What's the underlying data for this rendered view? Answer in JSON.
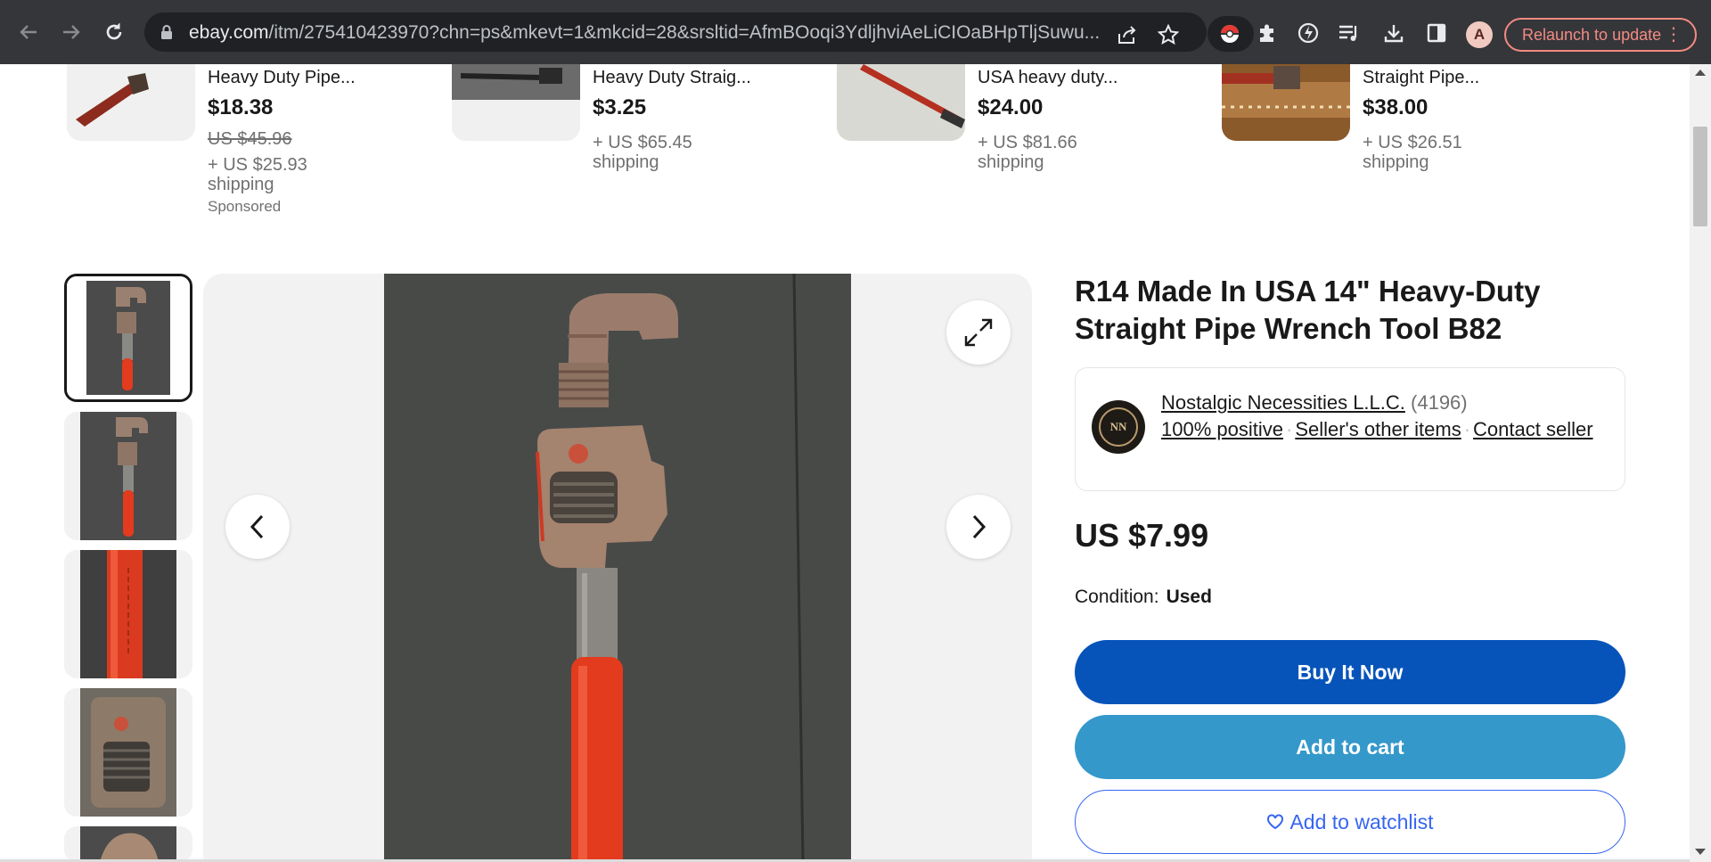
{
  "browser": {
    "url_host": "ebay.com",
    "url_path": "/itm/275410423970?chn=ps&mkevt=1&mkcid=28&srsltid=AfmBOoqi3YdljhviAeLiCIOaBHpTljSuwu...",
    "profile_initial": "A",
    "relaunch_label": "Relaunch to update"
  },
  "related": [
    {
      "title": "Heavy Duty Pipe...",
      "price": "$18.38",
      "original_price": "US $45.96",
      "shipping": "+ US $25.93 shipping",
      "sponsored": "Sponsored"
    },
    {
      "title": "Heavy Duty Straig...",
      "price": "$3.25",
      "shipping": "+ US $65.45 shipping"
    },
    {
      "title": "USA heavy duty...",
      "price": "$24.00",
      "shipping": "+ US $81.66 shipping"
    },
    {
      "title": "Straight Pipe...",
      "price": "$38.00",
      "shipping": "+ US $26.51 shipping"
    }
  ],
  "product": {
    "title": "R14 Made In USA 14\" Heavy-Duty Straight Pipe Wrench Tool B82",
    "price": "US $7.99",
    "condition_label": "Condition:",
    "condition_value": "Used"
  },
  "seller": {
    "name": "Nostalgic Necessities L.L.C.",
    "feedback_count": "(4196)",
    "positive": "100% positive",
    "other_items": "Seller's other items",
    "contact": "Contact seller",
    "logo_text": "NN"
  },
  "actions": {
    "buy_now": "Buy It Now",
    "add_to_cart": "Add to cart",
    "add_to_watchlist": "Add to watchlist"
  },
  "colors": {
    "buy_now": "#0654ba",
    "add_to_cart": "#3498ca",
    "watchlist": "#3665f3",
    "chrome_bg": "#35363a"
  }
}
